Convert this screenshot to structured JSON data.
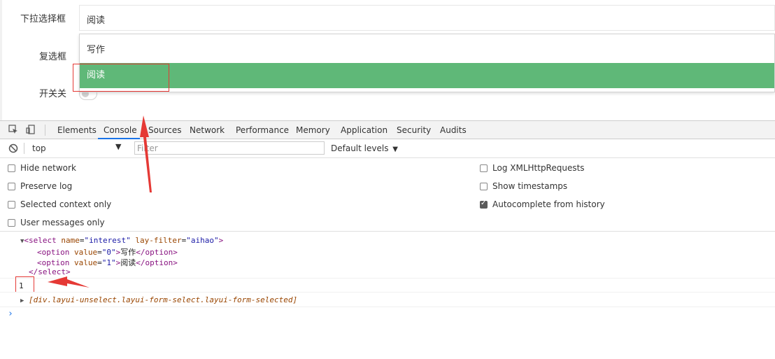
{
  "form": {
    "select_label": "下拉选择框",
    "select_value": "阅读",
    "checkbox_label": "复选框",
    "switch_label": "开关关",
    "options": [
      {
        "label": "写作",
        "selected": false
      },
      {
        "label": "阅读",
        "selected": true
      }
    ],
    "highlight_color": "#5fb878"
  },
  "devtools": {
    "tabs": [
      "Elements",
      "Console",
      "Sources",
      "Network",
      "Performance",
      "Memory",
      "Application",
      "Security",
      "Audits"
    ],
    "active_tab": "Console",
    "context": "top",
    "filter_placeholder": "Filter",
    "levels": "Default levels",
    "settings_left": [
      {
        "label": "Hide network",
        "checked": false
      },
      {
        "label": "Preserve log",
        "checked": false
      },
      {
        "label": "Selected context only",
        "checked": false
      },
      {
        "label": "User messages only",
        "checked": false
      }
    ],
    "settings_right": [
      {
        "label": "Log XMLHttpRequests",
        "checked": false
      },
      {
        "label": "Show timestamps",
        "checked": false
      },
      {
        "label": "Autocomplete from history",
        "checked": true
      }
    ]
  },
  "console": {
    "select_open": "select",
    "attr_name": "name",
    "attr_name_val": "\"interest\"",
    "attr_filter": "lay-filter",
    "attr_filter_val": "\"aihao\"",
    "option_tag": "option",
    "attr_value": "value",
    "opt0_val": "\"0\"",
    "opt0_text": "写作",
    "opt1_val": "\"1\"",
    "opt1_text": "阅读",
    "output_value": "1",
    "div_output": "[div.layui-unselect.layui-form-select.layui-form-selected]"
  }
}
